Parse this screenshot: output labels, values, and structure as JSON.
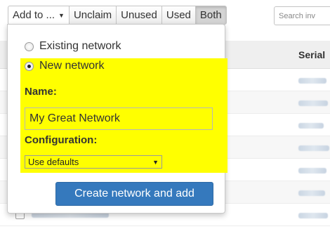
{
  "toolbar": {
    "add_to_label": "Add to ...",
    "unclaim_label": "Unclaim",
    "unused_label": "Unused",
    "used_label": "Used",
    "both_label": "Both",
    "active_filter": "Both"
  },
  "search": {
    "placeholder": "Search inv"
  },
  "table": {
    "serial_header": "Serial"
  },
  "dropdown": {
    "options": [
      {
        "label": "Existing network",
        "checked": false
      },
      {
        "label": "New network",
        "checked": true
      }
    ],
    "name_label": "Name:",
    "name_value": "My Great Network",
    "configuration_label": "Configuration:",
    "configuration_selected": "Use defaults",
    "submit_label": "Create network and add"
  },
  "colors": {
    "highlight": "#ffff00",
    "primary_button": "#3579bd",
    "active_toggle": "#d4d4d4"
  },
  "icons": {
    "dropdown_caret": "caret-down-icon",
    "select_arrow": "triangle-down-icon"
  }
}
